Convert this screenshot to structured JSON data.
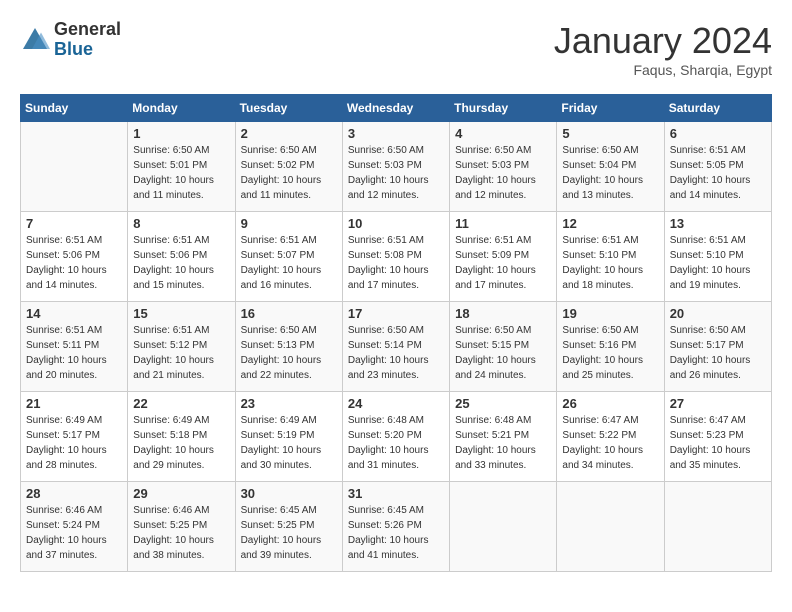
{
  "header": {
    "logo_general": "General",
    "logo_blue": "Blue",
    "month": "January 2024",
    "location": "Faqus, Sharqia, Egypt"
  },
  "days_of_week": [
    "Sunday",
    "Monday",
    "Tuesday",
    "Wednesday",
    "Thursday",
    "Friday",
    "Saturday"
  ],
  "weeks": [
    [
      {
        "day": "",
        "sunrise": "",
        "sunset": "",
        "daylight": ""
      },
      {
        "day": "1",
        "sunrise": "6:50 AM",
        "sunset": "5:01 PM",
        "daylight": "10 hours and 11 minutes."
      },
      {
        "day": "2",
        "sunrise": "6:50 AM",
        "sunset": "5:02 PM",
        "daylight": "10 hours and 11 minutes."
      },
      {
        "day": "3",
        "sunrise": "6:50 AM",
        "sunset": "5:03 PM",
        "daylight": "10 hours and 12 minutes."
      },
      {
        "day": "4",
        "sunrise": "6:50 AM",
        "sunset": "5:03 PM",
        "daylight": "10 hours and 12 minutes."
      },
      {
        "day": "5",
        "sunrise": "6:50 AM",
        "sunset": "5:04 PM",
        "daylight": "10 hours and 13 minutes."
      },
      {
        "day": "6",
        "sunrise": "6:51 AM",
        "sunset": "5:05 PM",
        "daylight": "10 hours and 14 minutes."
      }
    ],
    [
      {
        "day": "7",
        "sunrise": "6:51 AM",
        "sunset": "5:06 PM",
        "daylight": "10 hours and 14 minutes."
      },
      {
        "day": "8",
        "sunrise": "6:51 AM",
        "sunset": "5:06 PM",
        "daylight": "10 hours and 15 minutes."
      },
      {
        "day": "9",
        "sunrise": "6:51 AM",
        "sunset": "5:07 PM",
        "daylight": "10 hours and 16 minutes."
      },
      {
        "day": "10",
        "sunrise": "6:51 AM",
        "sunset": "5:08 PM",
        "daylight": "10 hours and 17 minutes."
      },
      {
        "day": "11",
        "sunrise": "6:51 AM",
        "sunset": "5:09 PM",
        "daylight": "10 hours and 17 minutes."
      },
      {
        "day": "12",
        "sunrise": "6:51 AM",
        "sunset": "5:10 PM",
        "daylight": "10 hours and 18 minutes."
      },
      {
        "day": "13",
        "sunrise": "6:51 AM",
        "sunset": "5:10 PM",
        "daylight": "10 hours and 19 minutes."
      }
    ],
    [
      {
        "day": "14",
        "sunrise": "6:51 AM",
        "sunset": "5:11 PM",
        "daylight": "10 hours and 20 minutes."
      },
      {
        "day": "15",
        "sunrise": "6:51 AM",
        "sunset": "5:12 PM",
        "daylight": "10 hours and 21 minutes."
      },
      {
        "day": "16",
        "sunrise": "6:50 AM",
        "sunset": "5:13 PM",
        "daylight": "10 hours and 22 minutes."
      },
      {
        "day": "17",
        "sunrise": "6:50 AM",
        "sunset": "5:14 PM",
        "daylight": "10 hours and 23 minutes."
      },
      {
        "day": "18",
        "sunrise": "6:50 AM",
        "sunset": "5:15 PM",
        "daylight": "10 hours and 24 minutes."
      },
      {
        "day": "19",
        "sunrise": "6:50 AM",
        "sunset": "5:16 PM",
        "daylight": "10 hours and 25 minutes."
      },
      {
        "day": "20",
        "sunrise": "6:50 AM",
        "sunset": "5:17 PM",
        "daylight": "10 hours and 26 minutes."
      }
    ],
    [
      {
        "day": "21",
        "sunrise": "6:49 AM",
        "sunset": "5:17 PM",
        "daylight": "10 hours and 28 minutes."
      },
      {
        "day": "22",
        "sunrise": "6:49 AM",
        "sunset": "5:18 PM",
        "daylight": "10 hours and 29 minutes."
      },
      {
        "day": "23",
        "sunrise": "6:49 AM",
        "sunset": "5:19 PM",
        "daylight": "10 hours and 30 minutes."
      },
      {
        "day": "24",
        "sunrise": "6:48 AM",
        "sunset": "5:20 PM",
        "daylight": "10 hours and 31 minutes."
      },
      {
        "day": "25",
        "sunrise": "6:48 AM",
        "sunset": "5:21 PM",
        "daylight": "10 hours and 33 minutes."
      },
      {
        "day": "26",
        "sunrise": "6:47 AM",
        "sunset": "5:22 PM",
        "daylight": "10 hours and 34 minutes."
      },
      {
        "day": "27",
        "sunrise": "6:47 AM",
        "sunset": "5:23 PM",
        "daylight": "10 hours and 35 minutes."
      }
    ],
    [
      {
        "day": "28",
        "sunrise": "6:46 AM",
        "sunset": "5:24 PM",
        "daylight": "10 hours and 37 minutes."
      },
      {
        "day": "29",
        "sunrise": "6:46 AM",
        "sunset": "5:25 PM",
        "daylight": "10 hours and 38 minutes."
      },
      {
        "day": "30",
        "sunrise": "6:45 AM",
        "sunset": "5:25 PM",
        "daylight": "10 hours and 39 minutes."
      },
      {
        "day": "31",
        "sunrise": "6:45 AM",
        "sunset": "5:26 PM",
        "daylight": "10 hours and 41 minutes."
      },
      {
        "day": "",
        "sunrise": "",
        "sunset": "",
        "daylight": ""
      },
      {
        "day": "",
        "sunrise": "",
        "sunset": "",
        "daylight": ""
      },
      {
        "day": "",
        "sunrise": "",
        "sunset": "",
        "daylight": ""
      }
    ]
  ]
}
